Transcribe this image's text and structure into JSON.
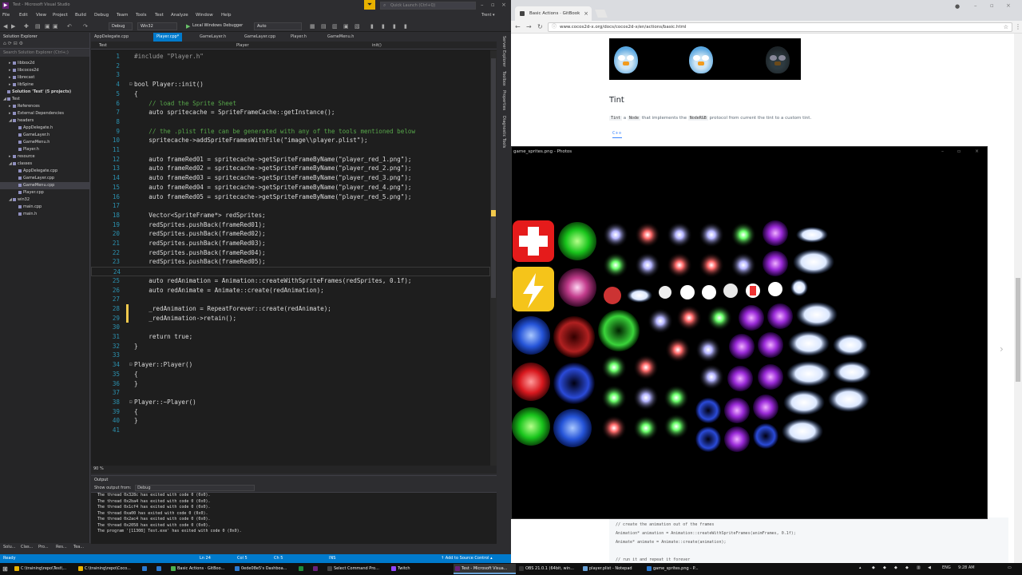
{
  "vs": {
    "title": "Test - Microsoft Visual Studio",
    "logo_glyph": "▶",
    "filter_icon": "funnel-icon",
    "quick_launch_placeholder": "Quick Launch (Ctrl+Q)",
    "user": "Trent ▾",
    "menu": [
      "File",
      "Edit",
      "View",
      "Project",
      "Build",
      "Debug",
      "Team",
      "Tools",
      "Test",
      "Analyze",
      "Window",
      "Help"
    ],
    "toolbar": {
      "config": "Debug",
      "platform": "Win32",
      "debugger": "Local Windows Debugger",
      "debugger_mode": "Auto"
    },
    "solution_explorer": {
      "title": "Solution Explorer",
      "search_placeholder": "Search Solution Explorer (Ctrl+;)",
      "items": [
        {
          "label": "libbox2d",
          "depth": 1,
          "arrow": "▸"
        },
        {
          "label": "libcocos2d",
          "depth": 1,
          "arrow": "▸"
        },
        {
          "label": "librecast",
          "depth": 1,
          "arrow": "▸"
        },
        {
          "label": "libSpine",
          "depth": 1,
          "arrow": "▸"
        },
        {
          "label": "Solution 'Test' (5 projects)",
          "depth": 0,
          "arrow": ""
        },
        {
          "label": "Test",
          "depth": 0,
          "arrow": "◢"
        },
        {
          "label": "References",
          "depth": 1,
          "arrow": "▸"
        },
        {
          "label": "External Dependencies",
          "depth": 1,
          "arrow": "▸"
        },
        {
          "label": "headers",
          "depth": 1,
          "arrow": "◢"
        },
        {
          "label": "AppDelegate.h",
          "depth": 2,
          "arrow": ""
        },
        {
          "label": "GameLayer.h",
          "depth": 2,
          "arrow": ""
        },
        {
          "label": "GameMenu.h",
          "depth": 2,
          "arrow": ""
        },
        {
          "label": "Player.h",
          "depth": 2,
          "arrow": ""
        },
        {
          "label": "resource",
          "depth": 1,
          "arrow": "▸"
        },
        {
          "label": "classes",
          "depth": 1,
          "arrow": "◢"
        },
        {
          "label": "AppDelegate.cpp",
          "depth": 2,
          "arrow": ""
        },
        {
          "label": "GameLayer.cpp",
          "depth": 2,
          "arrow": ""
        },
        {
          "label": "GameMenu.cpp",
          "depth": 2,
          "arrow": "",
          "selected": true
        },
        {
          "label": "Player.cpp",
          "depth": 2,
          "arrow": ""
        },
        {
          "label": "win32",
          "depth": 1,
          "arrow": "◢"
        },
        {
          "label": "main.cpp",
          "depth": 2,
          "arrow": ""
        },
        {
          "label": "main.h",
          "depth": 2,
          "arrow": ""
        }
      ],
      "bottom_tabs": [
        "Solu...",
        "Clas...",
        "Pro...",
        "Res...",
        "Tea..."
      ]
    },
    "editor": {
      "tabs": [
        {
          "label": "AppDelegate.cpp",
          "active": false
        },
        {
          "label": "Player.cpp*",
          "active": true
        },
        {
          "label": "GameLayer.h",
          "active": false
        },
        {
          "label": "GameLayer.cpp",
          "active": false
        },
        {
          "label": "Player.h",
          "active": false
        },
        {
          "label": "GameMenu.h",
          "active": false
        }
      ],
      "nav_project": "Test",
      "nav_class": "Player",
      "nav_member": "init()",
      "zoom": "90 %",
      "lines": [
        {
          "n": "1",
          "t": "#include \"Player.h\"",
          "c": "#9b9b9b"
        },
        {
          "n": "2",
          "t": ""
        },
        {
          "n": "3",
          "t": ""
        },
        {
          "n": "4",
          "t": "bool Player::init()",
          "fold": "⊟"
        },
        {
          "n": "5",
          "t": "{"
        },
        {
          "n": "6",
          "t": "    // load the Sprite Sheet",
          "c": "#57a64a"
        },
        {
          "n": "7",
          "t": "    auto spritecache = SpriteFrameCache::getInstance();"
        },
        {
          "n": "8",
          "t": ""
        },
        {
          "n": "9",
          "t": "    // the .plist file can be generated with any of the tools mentioned below",
          "c": "#57a64a"
        },
        {
          "n": "10",
          "t": "    spritecache->addSpriteFramesWithFile(\"image\\\\player.plist\");"
        },
        {
          "n": "11",
          "t": ""
        },
        {
          "n": "12",
          "t": "    auto frameRed01 = spritecache->getSpriteFrameByName(\"player_red_1.png\");"
        },
        {
          "n": "13",
          "t": "    auto frameRed02 = spritecache->getSpriteFrameByName(\"player_red_2.png\");"
        },
        {
          "n": "14",
          "t": "    auto frameRed03 = spritecache->getSpriteFrameByName(\"player_red_3.png\");"
        },
        {
          "n": "15",
          "t": "    auto frameRed04 = spritecache->getSpriteFrameByName(\"player_red_4.png\");"
        },
        {
          "n": "16",
          "t": "    auto frameRed05 = spritecache->getSpriteFrameByName(\"player_red_5.png\");"
        },
        {
          "n": "17",
          "t": ""
        },
        {
          "n": "18",
          "t": "    Vector<SpriteFrame*> redSprites;"
        },
        {
          "n": "19",
          "t": "    redSprites.pushBack(frameRed01);"
        },
        {
          "n": "20",
          "t": "    redSprites.pushBack(frameRed02);"
        },
        {
          "n": "21",
          "t": "    redSprites.pushBack(frameRed03);"
        },
        {
          "n": "22",
          "t": "    redSprites.pushBack(frameRed04);"
        },
        {
          "n": "23",
          "t": "    redSprites.pushBack(frameRed05);"
        },
        {
          "n": "24",
          "t": "",
          "current": true
        },
        {
          "n": "25",
          "t": "    auto redAnimation = Animation::createWithSpriteFrames(redSprites, 0.1f);"
        },
        {
          "n": "26",
          "t": "    auto redAnimate = Animate::create(redAnimation);"
        },
        {
          "n": "27",
          "t": ""
        },
        {
          "n": "28",
          "t": "    _redAnimation = RepeatForever::create(redAnimate);",
          "changed": true
        },
        {
          "n": "29",
          "t": "    _redAnimation->retain();",
          "changed": true
        },
        {
          "n": "30",
          "t": ""
        },
        {
          "n": "31",
          "t": "    return true;"
        },
        {
          "n": "32",
          "t": "}"
        },
        {
          "n": "33",
          "t": ""
        },
        {
          "n": "34",
          "t": "Player::Player()",
          "fold": "⊟"
        },
        {
          "n": "35",
          "t": "{"
        },
        {
          "n": "36",
          "t": "}"
        },
        {
          "n": "37",
          "t": ""
        },
        {
          "n": "38",
          "t": "Player::~Player()",
          "fold": "⊟"
        },
        {
          "n": "39",
          "t": "{"
        },
        {
          "n": "40",
          "t": "}"
        },
        {
          "n": "41",
          "t": ""
        }
      ]
    },
    "output": {
      "title": "Output",
      "show_from_label": "Show output from:",
      "show_from_value": "Debug",
      "lines": [
        "The thread 0x328c has exited with code 0 (0x0).",
        "The thread 0x2ba4 has exited with code 0 (0x0).",
        "The thread 0x1cf4 has exited with code 0 (0x0).",
        "The thread 0xa00 has exited with code 0 (0x0).",
        "The thread 0x2ac4 has exited with code 0 (0x0).",
        "The thread 0x2058 has exited with code 0 (0x0).",
        "The program '[11308] Test.exe' has exited with code 0 (0x0)."
      ]
    },
    "right_strip": [
      "Server Explorer",
      "Toolbox",
      "Properties",
      "Diagnostic Tools"
    ],
    "status": {
      "ready": "Ready",
      "line": "Ln 24",
      "col": "Col 5",
      "ch": "Ch 5",
      "ins": "INS",
      "source_control": "↑ Add to Source Control ▴"
    }
  },
  "browser": {
    "tab_title": "Basic Actions · GitBook",
    "url": "www.cocos2d-x.org/docs/cocos2d-x/en/actions/basic.html",
    "page": {
      "heading": "Tint",
      "desc_chip1": "Tint",
      "desc_a": "a",
      "desc_chip2": "Node",
      "desc_mid": "that implements the",
      "desc_chip3": "NodeRGB",
      "desc_end": "protocol from current the tint to a custom tint.",
      "code_tab": "C++",
      "snippet": [
        "// create the animation out of the frames",
        "Animation* animation = Animation::createWithSpriteFrames(animFrames, 0.1f);",
        "Animate* animate = Animate::create(animation);",
        "",
        "// run it and repeat it forever"
      ]
    }
  },
  "photos": {
    "title": "game_sprites.png - Photos"
  },
  "taskbar": {
    "items": [
      {
        "label": "C:\\training\\repo\\Test\\...",
        "color": "#e8b200"
      },
      {
        "label": "C:\\training\\repo\\Coco...",
        "color": "#e8b200"
      },
      {
        "label": "",
        "color": "#2b79d0"
      },
      {
        "label": "",
        "color": "#2b79d0"
      },
      {
        "label": "Basic Actions · GitBoo...",
        "color": "#4caf50"
      },
      {
        "label": "0ede08e5's Dashboa...",
        "color": "#2b79d0"
      },
      {
        "label": "",
        "color": "#1d8c3b"
      },
      {
        "label": "",
        "color": "#68217a"
      },
      {
        "label": "Select Command Pro...",
        "color": "#444"
      },
      {
        "label": "Twitch",
        "color": "#9146ff"
      },
      {
        "label": "Test - Microsoft Visua...",
        "color": "#68217a",
        "active": true
      },
      {
        "label": "OBS 21.0.1 (64bit, win...",
        "color": "#333"
      },
      {
        "label": "player.plist - Notepad",
        "color": "#6aa3d8"
      },
      {
        "label": "game_sprites.png - P...",
        "color": "#2b79d0"
      }
    ],
    "lang": "ENG",
    "time": "9:28 AM"
  }
}
